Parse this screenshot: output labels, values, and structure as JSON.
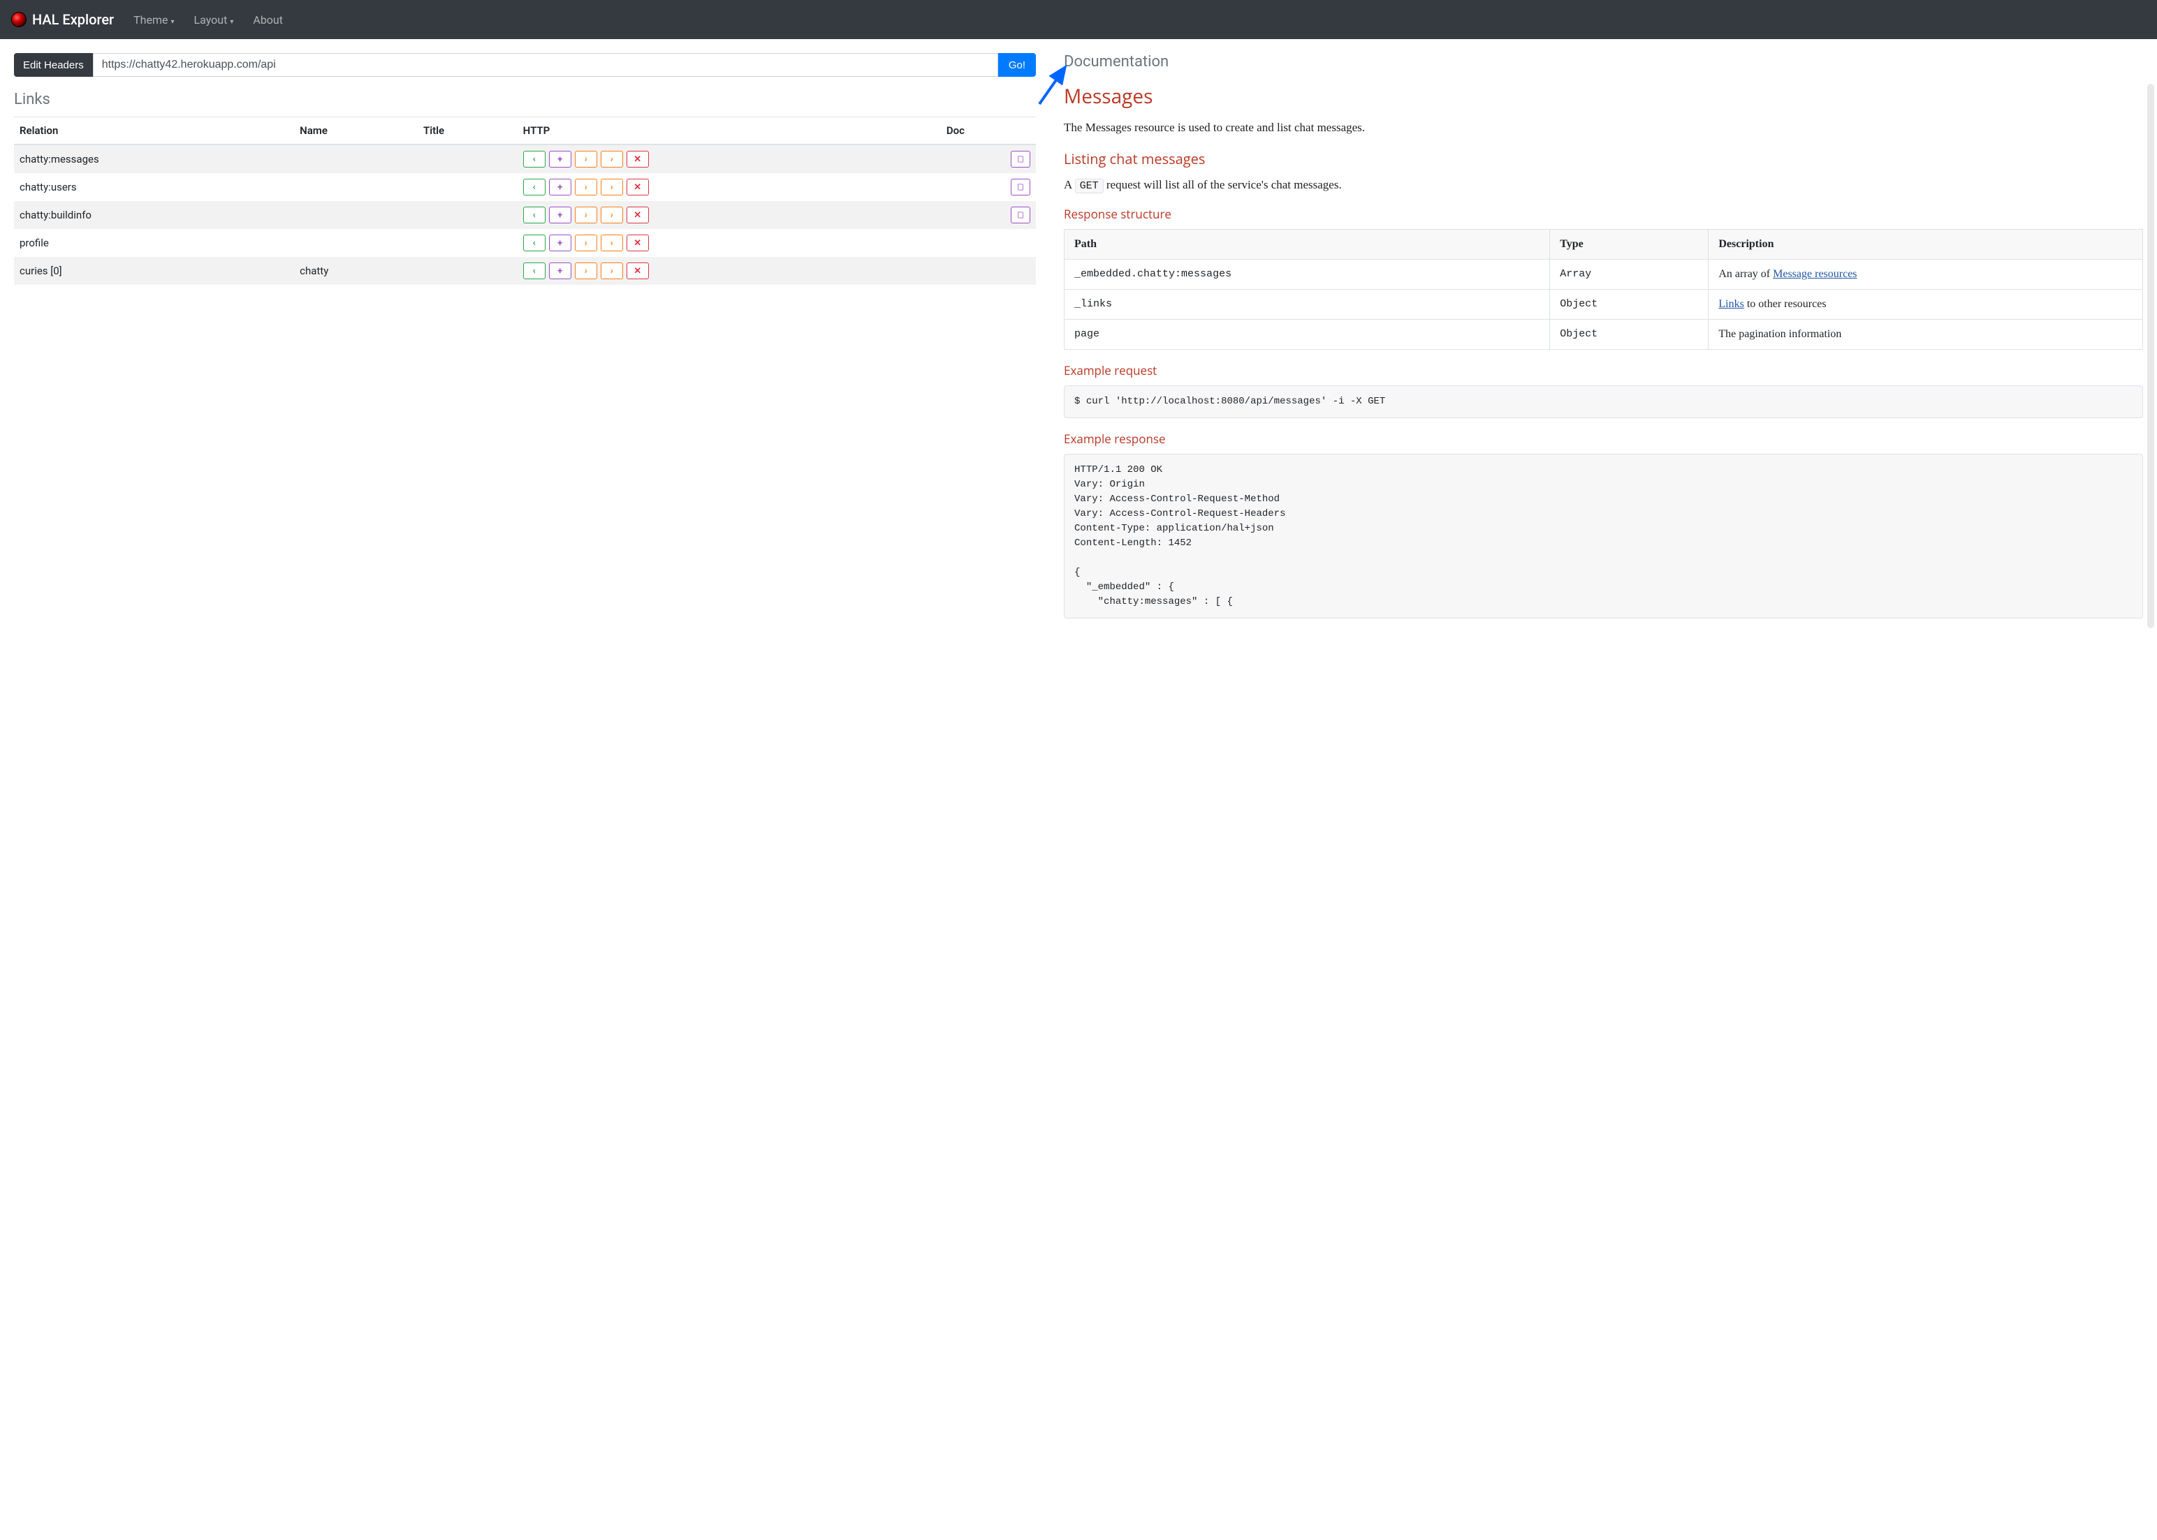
{
  "navbar": {
    "brand": "HAL Explorer",
    "theme": "Theme",
    "layout": "Layout",
    "about": "About"
  },
  "url_bar": {
    "edit_headers": "Edit Headers",
    "url": "https://chatty42.herokuapp.com/api",
    "go": "Go!"
  },
  "links_section_title": "Links",
  "links_headers": {
    "relation": "Relation",
    "name": "Name",
    "title": "Title",
    "http": "HTTP",
    "doc": "Doc"
  },
  "links": [
    {
      "relation": "chatty:messages",
      "name": "",
      "title": "",
      "has_doc": true
    },
    {
      "relation": "chatty:users",
      "name": "",
      "title": "",
      "has_doc": true
    },
    {
      "relation": "chatty:buildinfo",
      "name": "",
      "title": "",
      "has_doc": true
    },
    {
      "relation": "profile",
      "name": "",
      "title": "",
      "has_doc": false
    },
    {
      "relation": "curies [0]",
      "name": "chatty",
      "title": "",
      "has_doc": false
    }
  ],
  "doc_section_title": "Documentation",
  "doc": {
    "title": "Messages",
    "intro": "The Messages resource is used to create and list chat messages.",
    "listing_heading": "Listing chat messages",
    "listing_text_pre": "A ",
    "listing_code": "GET",
    "listing_text_post": " request will list all of the service's chat messages.",
    "response_structure_heading": "Response structure",
    "table_headers": {
      "path": "Path",
      "type": "Type",
      "description": "Description"
    },
    "rows": [
      {
        "path": "_embedded.chatty:messages",
        "type": "Array",
        "desc_pre": "An array of ",
        "desc_link": "Message resources",
        "desc_post": ""
      },
      {
        "path": "_links",
        "type": "Object",
        "desc_pre": "",
        "desc_link": "Links",
        "desc_post": " to other resources"
      },
      {
        "path": "page",
        "type": "Object",
        "desc_pre": "The pagination information",
        "desc_link": "",
        "desc_post": ""
      }
    ],
    "example_request_heading": "Example request",
    "example_request": "$ curl 'http://localhost:8080/api/messages' -i -X GET",
    "example_response_heading": "Example response",
    "example_response": "HTTP/1.1 200 OK\nVary: Origin\nVary: Access-Control-Request-Method\nVary: Access-Control-Request-Headers\nContent-Type: application/hal+json\nContent-Length: 1452\n\n{\n  \"_embedded\" : {\n    \"chatty:messages\" : [ {"
  }
}
